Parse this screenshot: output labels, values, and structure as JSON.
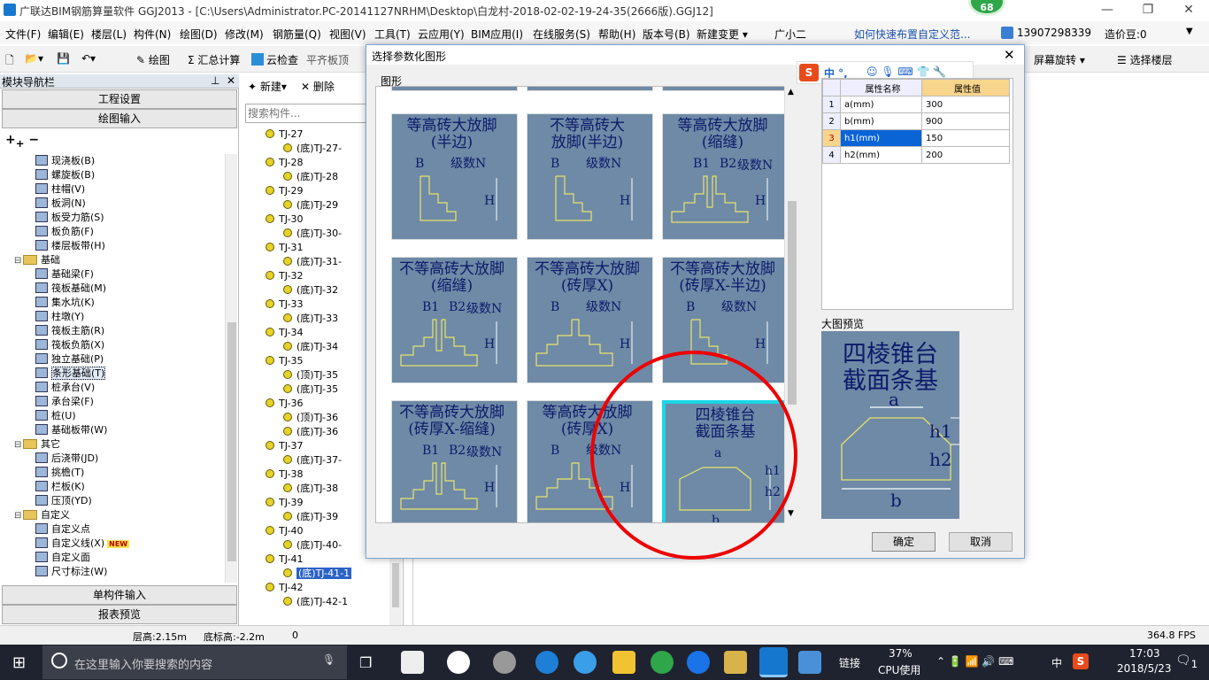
{
  "window": {
    "title": "广联达BIM钢筋算量软件 GGJ2013 - [C:\\Users\\Administrator.PC-20141127NRHM\\Desktop\\白龙村-2018-02-02-19-24-35(2666版).GGJ12]",
    "badge": "68"
  },
  "menu": {
    "items": [
      "文件(F)",
      "编辑(E)",
      "楼层(L)",
      "构件(N)",
      "绘图(D)",
      "修改(M)",
      "钢筋量(Q)",
      "视图(V)",
      "工具(T)",
      "云应用(Y)",
      "BIM应用(I)",
      "在线服务(S)",
      "帮助(H)",
      "版本号(B)",
      "新建变更 ▾",
      "广小二",
      "如何快速布置自定义范..."
    ],
    "user": "13907298339",
    "price_bean": "造价豆:0"
  },
  "toolbar": {
    "draw": "绘图",
    "summary_calc": "汇总计算",
    "cloud_check": "云检查",
    "flat_slab": "平齐板顶",
    "screen_rotate": "屏幕旋转",
    "select_floor": "选择楼层"
  },
  "left_panel": {
    "title": "模块导航栏",
    "project_settings": "工程设置",
    "drawing_input": "绘图输入",
    "single_input": "单构件输入",
    "report_preview": "报表预览",
    "tree": [
      {
        "label": "现浇板(B)",
        "indent": 3,
        "type": "item"
      },
      {
        "label": "螺旋板(B)",
        "indent": 3,
        "type": "item"
      },
      {
        "label": "柱帽(V)",
        "indent": 3,
        "type": "item"
      },
      {
        "label": "板洞(N)",
        "indent": 3,
        "type": "item"
      },
      {
        "label": "板受力筋(S)",
        "indent": 3,
        "type": "item"
      },
      {
        "label": "板负筋(F)",
        "indent": 3,
        "type": "item"
      },
      {
        "label": "楼层板带(H)",
        "indent": 3,
        "type": "item"
      },
      {
        "label": "基础",
        "indent": 1,
        "type": "folder"
      },
      {
        "label": "基础梁(F)",
        "indent": 3,
        "type": "item"
      },
      {
        "label": "筏板基础(M)",
        "indent": 3,
        "type": "item"
      },
      {
        "label": "集水坑(K)",
        "indent": 3,
        "type": "item"
      },
      {
        "label": "柱墩(Y)",
        "indent": 3,
        "type": "item"
      },
      {
        "label": "筏板主筋(R)",
        "indent": 3,
        "type": "item"
      },
      {
        "label": "筏板负筋(X)",
        "indent": 3,
        "type": "item"
      },
      {
        "label": "独立基础(P)",
        "indent": 3,
        "type": "item"
      },
      {
        "label": "条形基础(T)",
        "indent": 3,
        "type": "item",
        "selected": true
      },
      {
        "label": "桩承台(V)",
        "indent": 3,
        "type": "item"
      },
      {
        "label": "承台梁(F)",
        "indent": 3,
        "type": "item"
      },
      {
        "label": "桩(U)",
        "indent": 3,
        "type": "item"
      },
      {
        "label": "基础板带(W)",
        "indent": 3,
        "type": "item"
      },
      {
        "label": "其它",
        "indent": 1,
        "type": "folder"
      },
      {
        "label": "后浇带(JD)",
        "indent": 3,
        "type": "item"
      },
      {
        "label": "挑檐(T)",
        "indent": 3,
        "type": "item"
      },
      {
        "label": "栏板(K)",
        "indent": 3,
        "type": "item"
      },
      {
        "label": "压顶(YD)",
        "indent": 3,
        "type": "item"
      },
      {
        "label": "自定义",
        "indent": 1,
        "type": "folder"
      },
      {
        "label": "自定义点",
        "indent": 3,
        "type": "item"
      },
      {
        "label": "自定义线(X)",
        "indent": 3,
        "type": "item",
        "new": "NEW"
      },
      {
        "label": "自定义面",
        "indent": 3,
        "type": "item"
      },
      {
        "label": "尺寸标注(W)",
        "indent": 3,
        "type": "item"
      }
    ]
  },
  "mid_panel": {
    "new_btn": "新建",
    "delete_btn": "删除",
    "search_placeholder": "搜索构件...",
    "tree": [
      {
        "label": "TJ-27",
        "level": 0
      },
      {
        "label": "(底)TJ-27-",
        "level": 1
      },
      {
        "label": "TJ-28",
        "level": 0
      },
      {
        "label": "(底)TJ-28",
        "level": 1
      },
      {
        "label": "TJ-29",
        "level": 0
      },
      {
        "label": "(底)TJ-29",
        "level": 1
      },
      {
        "label": "TJ-30",
        "level": 0
      },
      {
        "label": "(底)TJ-30-",
        "level": 1
      },
      {
        "label": "TJ-31",
        "level": 0
      },
      {
        "label": "(底)TJ-31-",
        "level": 1
      },
      {
        "label": "TJ-32",
        "level": 0
      },
      {
        "label": "(底)TJ-32",
        "level": 1
      },
      {
        "label": "TJ-33",
        "level": 0
      },
      {
        "label": "(底)TJ-33",
        "level": 1
      },
      {
        "label": "TJ-34",
        "level": 0
      },
      {
        "label": "(底)TJ-34",
        "level": 1
      },
      {
        "label": "TJ-35",
        "level": 0
      },
      {
        "label": "(顶)TJ-35",
        "level": 1
      },
      {
        "label": "(底)TJ-35",
        "level": 1
      },
      {
        "label": "TJ-36",
        "level": 0
      },
      {
        "label": "(顶)TJ-36",
        "level": 1
      },
      {
        "label": "(底)TJ-36",
        "level": 1
      },
      {
        "label": "TJ-37",
        "level": 0
      },
      {
        "label": "(底)TJ-37-",
        "level": 1
      },
      {
        "label": "TJ-38",
        "level": 0
      },
      {
        "label": "(底)TJ-38",
        "level": 1
      },
      {
        "label": "TJ-39",
        "level": 0
      },
      {
        "label": "(底)TJ-39",
        "level": 1
      },
      {
        "label": "TJ-40",
        "level": 0
      },
      {
        "label": "(底)TJ-40-",
        "level": 1
      },
      {
        "label": "TJ-41",
        "level": 0
      },
      {
        "label": "(底)TJ-41-1",
        "level": 1,
        "selected": true
      },
      {
        "label": "TJ-42",
        "level": 0
      },
      {
        "label": "(底)TJ-42-1",
        "level": 1
      }
    ]
  },
  "dialog": {
    "title": "选择参数化图形",
    "section": "图形",
    "ime": "中 °,",
    "tiles": [
      {
        "title": "等高砖大放脚\n(半边)",
        "kind": "half",
        "labels": [
          "B",
          "级数N",
          "H"
        ]
      },
      {
        "title": "不等高砖大\n放脚(半边)",
        "kind": "half",
        "labels": [
          "B",
          "级数N",
          "H"
        ]
      },
      {
        "title": "等高砖大放脚\n(缩缝)",
        "kind": "joint",
        "labels": [
          "B1",
          "B2",
          "级数N",
          "H"
        ]
      },
      {
        "title": "不等高砖大放脚\n(缩缝)",
        "kind": "joint",
        "labels": [
          "B1",
          "B2",
          "级数N",
          "H"
        ]
      },
      {
        "title": "不等高砖大放脚\n(砖厚X)",
        "kind": "full",
        "labels": [
          "B",
          "级数N",
          "H"
        ]
      },
      {
        "title": "不等高砖大放脚\n(砖厚X-半边)",
        "kind": "half",
        "labels": [
          "B",
          "级数N",
          "H"
        ]
      },
      {
        "title": "不等高砖大放脚\n(砖厚X-缩缝)",
        "kind": "joint",
        "labels": [
          "B1",
          "B2",
          "级数N",
          "H"
        ]
      },
      {
        "title": "等高砖大放脚\n(砖厚X)",
        "kind": "full",
        "labels": [
          "B",
          "级数N",
          "H"
        ]
      },
      {
        "title": "四棱锥台\n截面条基",
        "kind": "trap",
        "labels": [
          "a",
          "h1",
          "h2",
          "b"
        ],
        "selected": true
      }
    ],
    "props_header": {
      "name": "属性名称",
      "value": "属性值"
    },
    "props": [
      {
        "idx": "1",
        "name": "a(mm)",
        "value": "300"
      },
      {
        "idx": "2",
        "name": "b(mm)",
        "value": "900"
      },
      {
        "idx": "3",
        "name": "h1(mm)",
        "value": "150",
        "selected": true
      },
      {
        "idx": "4",
        "name": "h2(mm)",
        "value": "200"
      }
    ],
    "preview_label": "大图预览",
    "preview_title": "四棱锥台\n截面条基",
    "preview_labels": {
      "a": "a",
      "h1": "h1",
      "h2": "h2",
      "b": "b"
    },
    "ok": "确定",
    "cancel": "取消"
  },
  "statusbar": {
    "floor_height": "层高:2.15m",
    "bottom_elev": "底标高:-2.2m",
    "zero": "0",
    "fps": "364.8 FPS"
  },
  "taskbar": {
    "search_placeholder": "在这里输入你要搜索的内容",
    "link": "链接",
    "cpu_pct": "37%",
    "cpu_label": "CPU使用",
    "lang": "中",
    "time": "17:03",
    "date": "2018/5/23",
    "notify": "1"
  },
  "colors": {
    "accent": "#0078d7",
    "tile_bg": "#6e8aa6",
    "selected_tile_border": "#19d6e6",
    "circle": "#e00000"
  }
}
